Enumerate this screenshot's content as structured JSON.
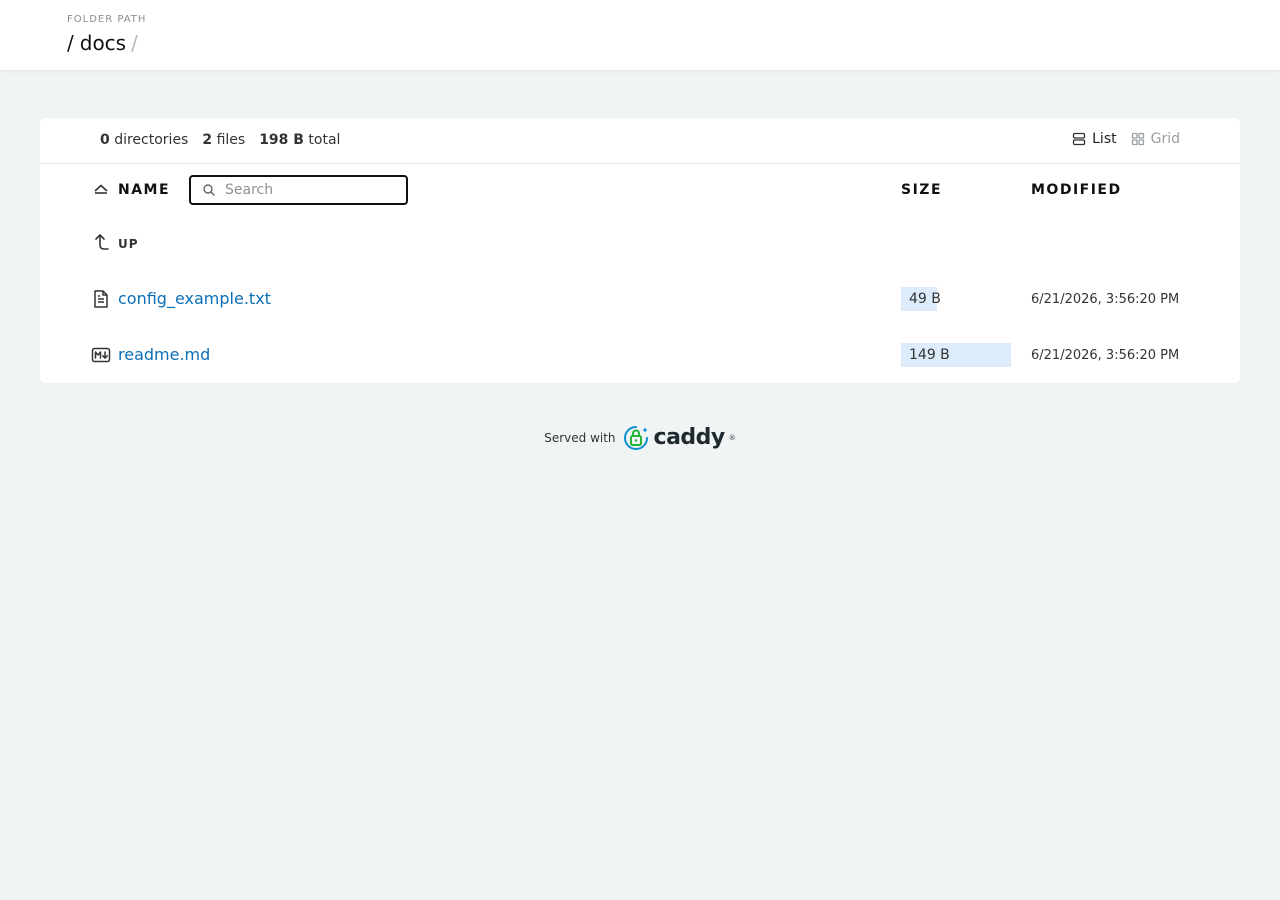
{
  "header": {
    "folder_label": "FOLDER PATH",
    "breadcrumb": {
      "root_separator": "/",
      "current": "docs",
      "trailing_separator": "/"
    }
  },
  "summary": {
    "directories_count": "0",
    "directories_label": "directories",
    "files_count": "2",
    "files_label": "files",
    "total_size": "198 B",
    "total_label": "total"
  },
  "layout_toggle": {
    "list_label": "List",
    "grid_label": "Grid",
    "active": "List"
  },
  "table": {
    "columns": {
      "name": "NAME",
      "size": "SIZE",
      "modified": "MODIFIED"
    },
    "search_placeholder": "Search",
    "up_label": "UP",
    "rows": [
      {
        "name": "config_example.txt",
        "icon": "text-file-icon",
        "size": "49 B",
        "size_fraction": 0.33,
        "modified": "6/21/2026, 3:56:20 PM"
      },
      {
        "name": "readme.md",
        "icon": "markdown-file-icon",
        "size": "149 B",
        "size_fraction": 1.0,
        "modified": "6/21/2026, 3:56:20 PM"
      }
    ]
  },
  "footer": {
    "served_with": "Served with",
    "brand": "caddy",
    "brand_mark": "®"
  },
  "colors": {
    "background": "#f1f4f5",
    "link": "#0b6fb8",
    "size_bar": "#dcecfb",
    "caddy_green": "#22b638",
    "caddy_blue": "#0c8ed3"
  }
}
